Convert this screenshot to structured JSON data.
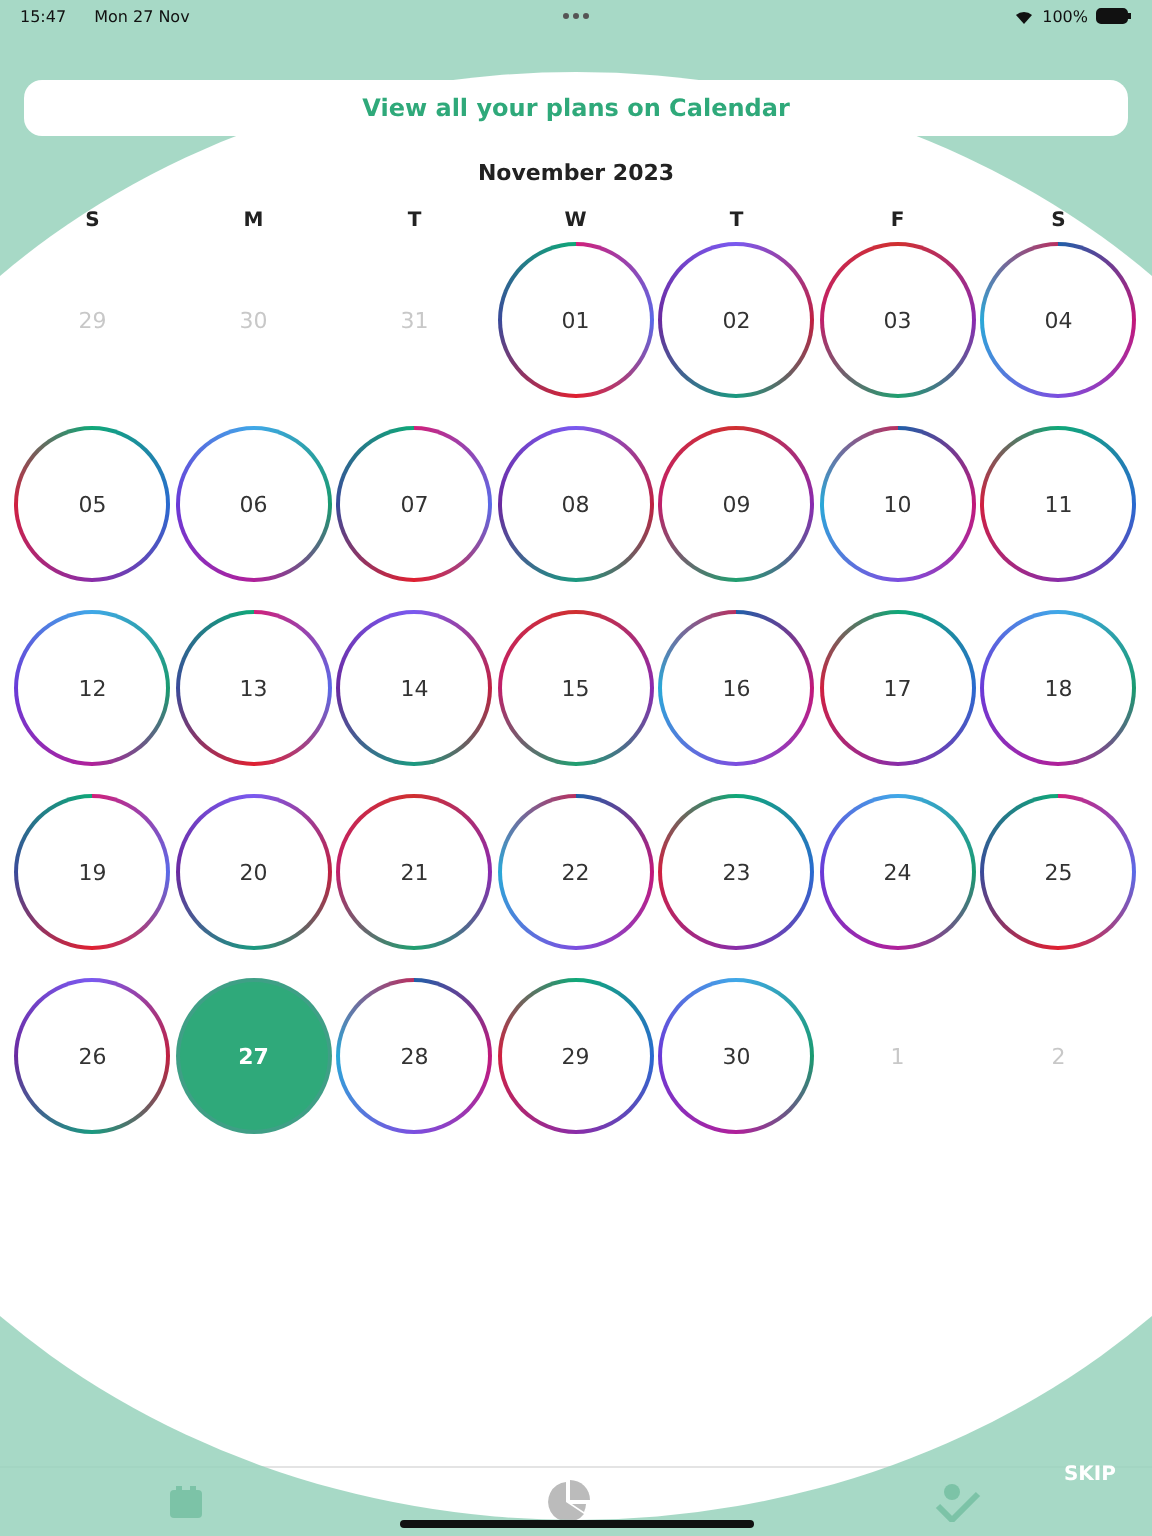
{
  "status_bar": {
    "time": "15:47",
    "date": "Mon 27 Nov",
    "battery": "100%"
  },
  "banner": {
    "label": "View all your plans on Calendar"
  },
  "calendar": {
    "title": "November 2023",
    "weekdays": [
      "S",
      "M",
      "T",
      "W",
      "T",
      "F",
      "S"
    ],
    "days": [
      {
        "label": "29",
        "in_month": false
      },
      {
        "label": "30",
        "in_month": false
      },
      {
        "label": "31",
        "in_month": false
      },
      {
        "label": "01",
        "in_month": true,
        "selected": false
      },
      {
        "label": "02",
        "in_month": true,
        "selected": false
      },
      {
        "label": "03",
        "in_month": true,
        "selected": false
      },
      {
        "label": "04",
        "in_month": true,
        "selected": false
      },
      {
        "label": "05",
        "in_month": true,
        "selected": false
      },
      {
        "label": "06",
        "in_month": true,
        "selected": false
      },
      {
        "label": "07",
        "in_month": true,
        "selected": false
      },
      {
        "label": "08",
        "in_month": true,
        "selected": false
      },
      {
        "label": "09",
        "in_month": true,
        "selected": false
      },
      {
        "label": "10",
        "in_month": true,
        "selected": false
      },
      {
        "label": "11",
        "in_month": true,
        "selected": false
      },
      {
        "label": "12",
        "in_month": true,
        "selected": false
      },
      {
        "label": "13",
        "in_month": true,
        "selected": false
      },
      {
        "label": "14",
        "in_month": true,
        "selected": false
      },
      {
        "label": "15",
        "in_month": true,
        "selected": false
      },
      {
        "label": "16",
        "in_month": true,
        "selected": false
      },
      {
        "label": "17",
        "in_month": true,
        "selected": false
      },
      {
        "label": "18",
        "in_month": true,
        "selected": false
      },
      {
        "label": "19",
        "in_month": true,
        "selected": false
      },
      {
        "label": "20",
        "in_month": true,
        "selected": false
      },
      {
        "label": "21",
        "in_month": true,
        "selected": false
      },
      {
        "label": "22",
        "in_month": true,
        "selected": false
      },
      {
        "label": "23",
        "in_month": true,
        "selected": false
      },
      {
        "label": "24",
        "in_month": true,
        "selected": false
      },
      {
        "label": "25",
        "in_month": true,
        "selected": false
      },
      {
        "label": "26",
        "in_month": true,
        "selected": false
      },
      {
        "label": "27",
        "in_month": true,
        "selected": true
      },
      {
        "label": "28",
        "in_month": true,
        "selected": false
      },
      {
        "label": "29",
        "in_month": true,
        "selected": false
      },
      {
        "label": "30",
        "in_month": true,
        "selected": false
      },
      {
        "label": "1",
        "in_month": false
      },
      {
        "label": "2",
        "in_month": false
      }
    ]
  },
  "skip": {
    "label": "SKIP"
  }
}
